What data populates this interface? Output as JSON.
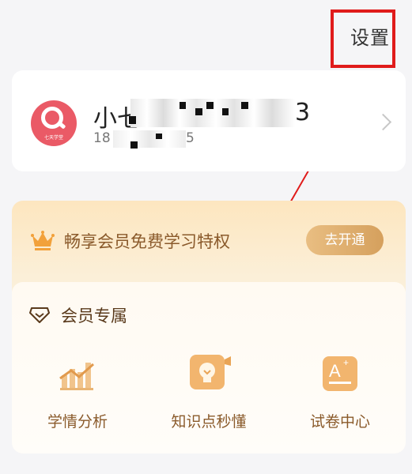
{
  "header": {
    "settings_label": "设置"
  },
  "profile": {
    "name_visible_start": "小七",
    "name_visible_end": "3",
    "phone_visible_start": "18",
    "phone_visible_end": "5",
    "avatar_logo_text": "七天学堂"
  },
  "vip": {
    "banner_text": "畅享会员免费学习特权",
    "open_button_label": "去开通",
    "section_title": "会员专属",
    "features": [
      {
        "label": "学情分析",
        "icon": "chart-icon"
      },
      {
        "label": "知识点秒懂",
        "icon": "lightbulb-icon"
      },
      {
        "label": "试卷中心",
        "icon": "exam-paper-icon"
      }
    ]
  },
  "colors": {
    "highlight_box": "#e01b1b",
    "accent_gold": "#d5a05d",
    "avatar_bg": "#ea5a66"
  }
}
